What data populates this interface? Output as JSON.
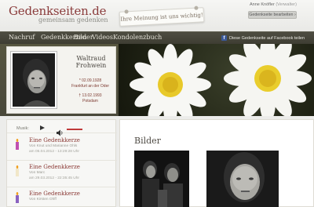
{
  "header": {
    "logo_title": "Gedenkseiten.de",
    "logo_subtitle": "gemeinsam gedenken",
    "note": "Ihre Meinung ist uns wichtig!",
    "admin_name": "Anne Knöfler",
    "admin_role": "(Verwalter)",
    "admin_button": "Gedenkseite bearbeiten ›"
  },
  "nav": {
    "items": [
      "Nachruf",
      "Gedenkkerzen",
      "Bilder",
      "Videos",
      "Kondolenzbuch"
    ],
    "facebook_share": "Diese Gedenkseite auf Facebook teilen"
  },
  "profile": {
    "name_line1": "Waltraud",
    "name_line2": "Frohwein",
    "birth_date": "* 02.09.1928",
    "birth_place": "Frankfurt an der Oder",
    "death_date": "† 13.02.1993",
    "death_place": "Potsdam"
  },
  "music": {
    "label": "Musik:"
  },
  "candles": [
    {
      "title": "Eine Gedenkkerze",
      "by": "Von Knut und Marianne Ohls",
      "date": "am 05.04.2012 - 13:29:28 Uhr"
    },
    {
      "title": "Eine Gedenkkerze",
      "by": "Von Marc",
      "date": "am 29.03.2012 - 22:35:45 Uhr"
    },
    {
      "title": "Eine Gedenkkerze",
      "by": "Von Kirsten Ohff",
      "date": ""
    }
  ],
  "gallery": {
    "title": "Bilder"
  },
  "colors": {
    "accent": "#8b3a36",
    "nav_bg": "#45443a",
    "hero_bg": "#504f3d"
  }
}
